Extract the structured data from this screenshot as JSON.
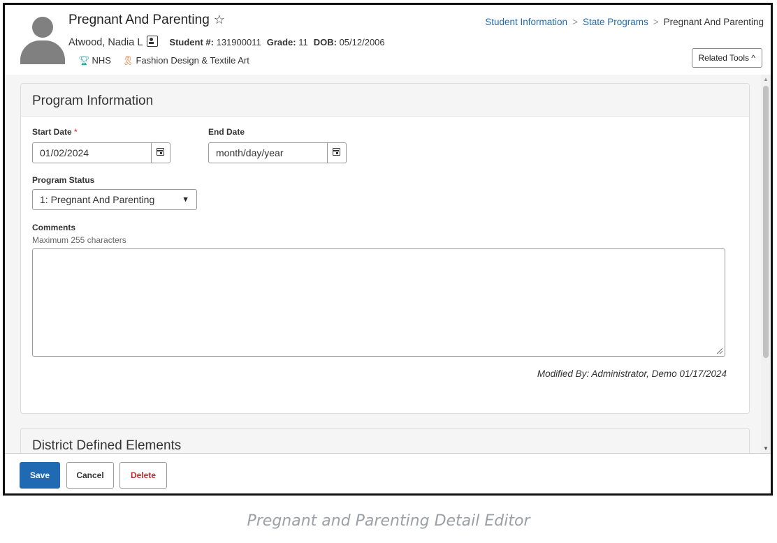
{
  "header": {
    "title": "Pregnant And Parenting",
    "student_name": "Atwood, Nadia L",
    "student_num_label": "Student #:",
    "student_num": "131900011",
    "grade_label": "Grade:",
    "grade": "11",
    "dob_label": "DOB:",
    "dob": "05/12/2006",
    "tags": [
      "NHS",
      "Fashion Design & Textile Art"
    ],
    "related_tools": "Related Tools"
  },
  "breadcrumb": [
    "Student Information",
    "State Programs",
    "Pregnant And Parenting"
  ],
  "program_info": {
    "heading": "Program Information",
    "start_date_label": "Start Date",
    "start_date_value": "01/02/2024",
    "end_date_label": "End Date",
    "end_date_placeholder": "month/day/year",
    "status_label": "Program Status",
    "status_value": "1: Pregnant And Parenting",
    "comments_label": "Comments",
    "comments_hint": "Maximum 255 characters",
    "comments_value": "",
    "modified": "Modified By: Administrator, Demo 01/17/2024"
  },
  "district": {
    "heading": "District Defined Elements"
  },
  "buttons": {
    "save": "Save",
    "cancel": "Cancel",
    "delete": "Delete"
  },
  "caption": "Pregnant and Parenting Detail Editor",
  "colors": {
    "accent": "#1f6ab3",
    "danger": "#c62828"
  },
  "icons": [
    "star-icon",
    "id-card-icon",
    "trophy-icon",
    "ribbon-icon",
    "calendar-icon",
    "caret-down-icon",
    "chevron-up-icon"
  ]
}
